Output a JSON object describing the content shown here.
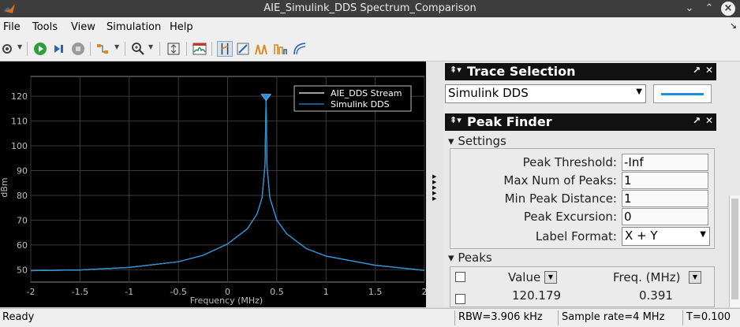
{
  "window": {
    "title": "AIE_Simulink_DDS Spectrum_Comparison"
  },
  "menu": {
    "items": [
      "File",
      "Tools",
      "View",
      "Simulation",
      "Help"
    ]
  },
  "chart_data": {
    "type": "line",
    "xlabel": "Frequency (MHz)",
    "ylabel": "dBm",
    "xlim": [
      -2,
      2
    ],
    "ylim": [
      45,
      128
    ],
    "xticks": [
      "-2",
      "-1.5",
      "-1",
      "-0.5",
      "0",
      "0.5",
      "1",
      "1.5",
      "2"
    ],
    "yticks": [
      "50",
      "60",
      "70",
      "80",
      "90",
      "100",
      "110",
      "120"
    ],
    "grid": true,
    "legend_position": "top-right",
    "series": [
      {
        "name": "AIE_DDS Stream",
        "color": "#ffffff",
        "x": [
          -2,
          -1.5,
          -1,
          -0.5,
          -0.25,
          0,
          0.2,
          0.3,
          0.35,
          0.38,
          0.391,
          0.4,
          0.43,
          0.5,
          0.6,
          0.8,
          1,
          1.5,
          2
        ],
        "y": [
          49.6,
          49.9,
          50.9,
          53.2,
          55.8,
          60.4,
          66.5,
          72.5,
          79,
          92,
          120.2,
          92,
          79,
          70,
          64.5,
          58.5,
          55.5,
          51.8,
          49.7
        ]
      },
      {
        "name": "Simulink DDS",
        "color": "#1f8fe0",
        "x": [
          -2,
          -1.5,
          -1,
          -0.5,
          -0.25,
          0,
          0.2,
          0.3,
          0.35,
          0.38,
          0.391,
          0.4,
          0.43,
          0.5,
          0.6,
          0.8,
          1,
          1.5,
          2
        ],
        "y": [
          49.6,
          49.9,
          50.9,
          53.2,
          55.8,
          60.4,
          66.5,
          72.5,
          79,
          92,
          120.2,
          92,
          79,
          70,
          64.5,
          58.5,
          55.5,
          51.8,
          49.7
        ]
      }
    ],
    "peak_marker": {
      "x": 0.391,
      "y": 120.179
    }
  },
  "trace_selection": {
    "title": "Trace Selection",
    "selected": "Simulink DDS",
    "line_color": "#1f8fe0"
  },
  "peak_finder": {
    "title": "Peak Finder",
    "settings_label": "Settings",
    "fields": [
      {
        "label": "Peak Threshold:",
        "value": "-Inf"
      },
      {
        "label": "Max Num of Peaks:",
        "value": "1"
      },
      {
        "label": "Min Peak Distance:",
        "value": "1"
      },
      {
        "label": "Peak Excursion:",
        "value": "0"
      }
    ],
    "label_format_label": "Label Format:",
    "label_format_value": "X + Y",
    "peaks_label": "Peaks",
    "columns": [
      "Value",
      "Freq. (MHz)"
    ],
    "rows": [
      {
        "value": "120.179",
        "freq": "0.391"
      }
    ]
  },
  "status": {
    "ready": "Ready",
    "rbw": "RBW=3.906 kHz",
    "sample_rate": "Sample rate=4 MHz",
    "time": "T=0.100"
  }
}
